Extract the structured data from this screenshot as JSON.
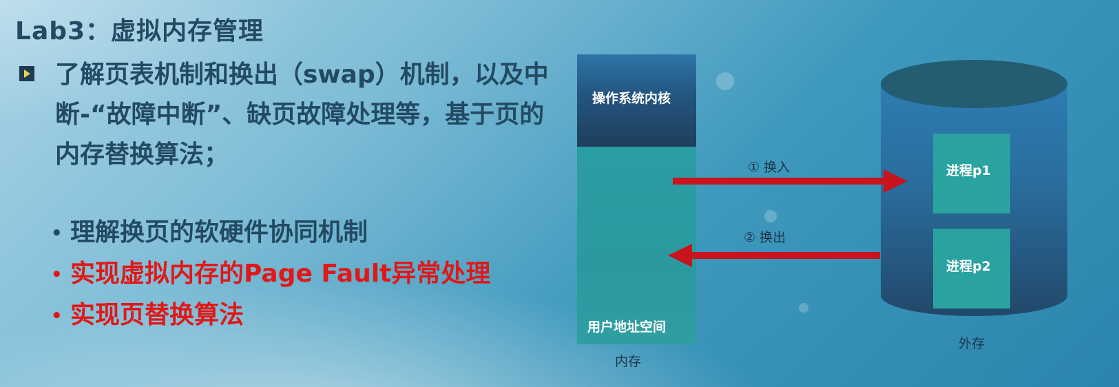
{
  "title": "Lab3：虚拟内存管理",
  "main_bullet": "了解页表机制和换出（swap）机制，以及中断-“故障中断”、缺页故障处理等，基于页的内存替换算法；",
  "sub_items": [
    {
      "text": "理解换页的软硬件协同机制",
      "color": "#234a63"
    },
    {
      "text": "实现虚拟内存的Page Fault异常处理",
      "color": "#e01818"
    },
    {
      "text": "实现页替换算法",
      "color": "#e01818"
    }
  ],
  "bullet_dot": "•",
  "diagram": {
    "memory": {
      "kernel_label": "操作系统内核",
      "user_label": "用户地址空间",
      "caption": "内存"
    },
    "storage": {
      "process1": "进程p1",
      "process2": "进程p2",
      "caption": "外存"
    },
    "arrows": {
      "swap_in": "① 换入",
      "swap_out": "② 换出",
      "color": "#c8141c"
    }
  }
}
